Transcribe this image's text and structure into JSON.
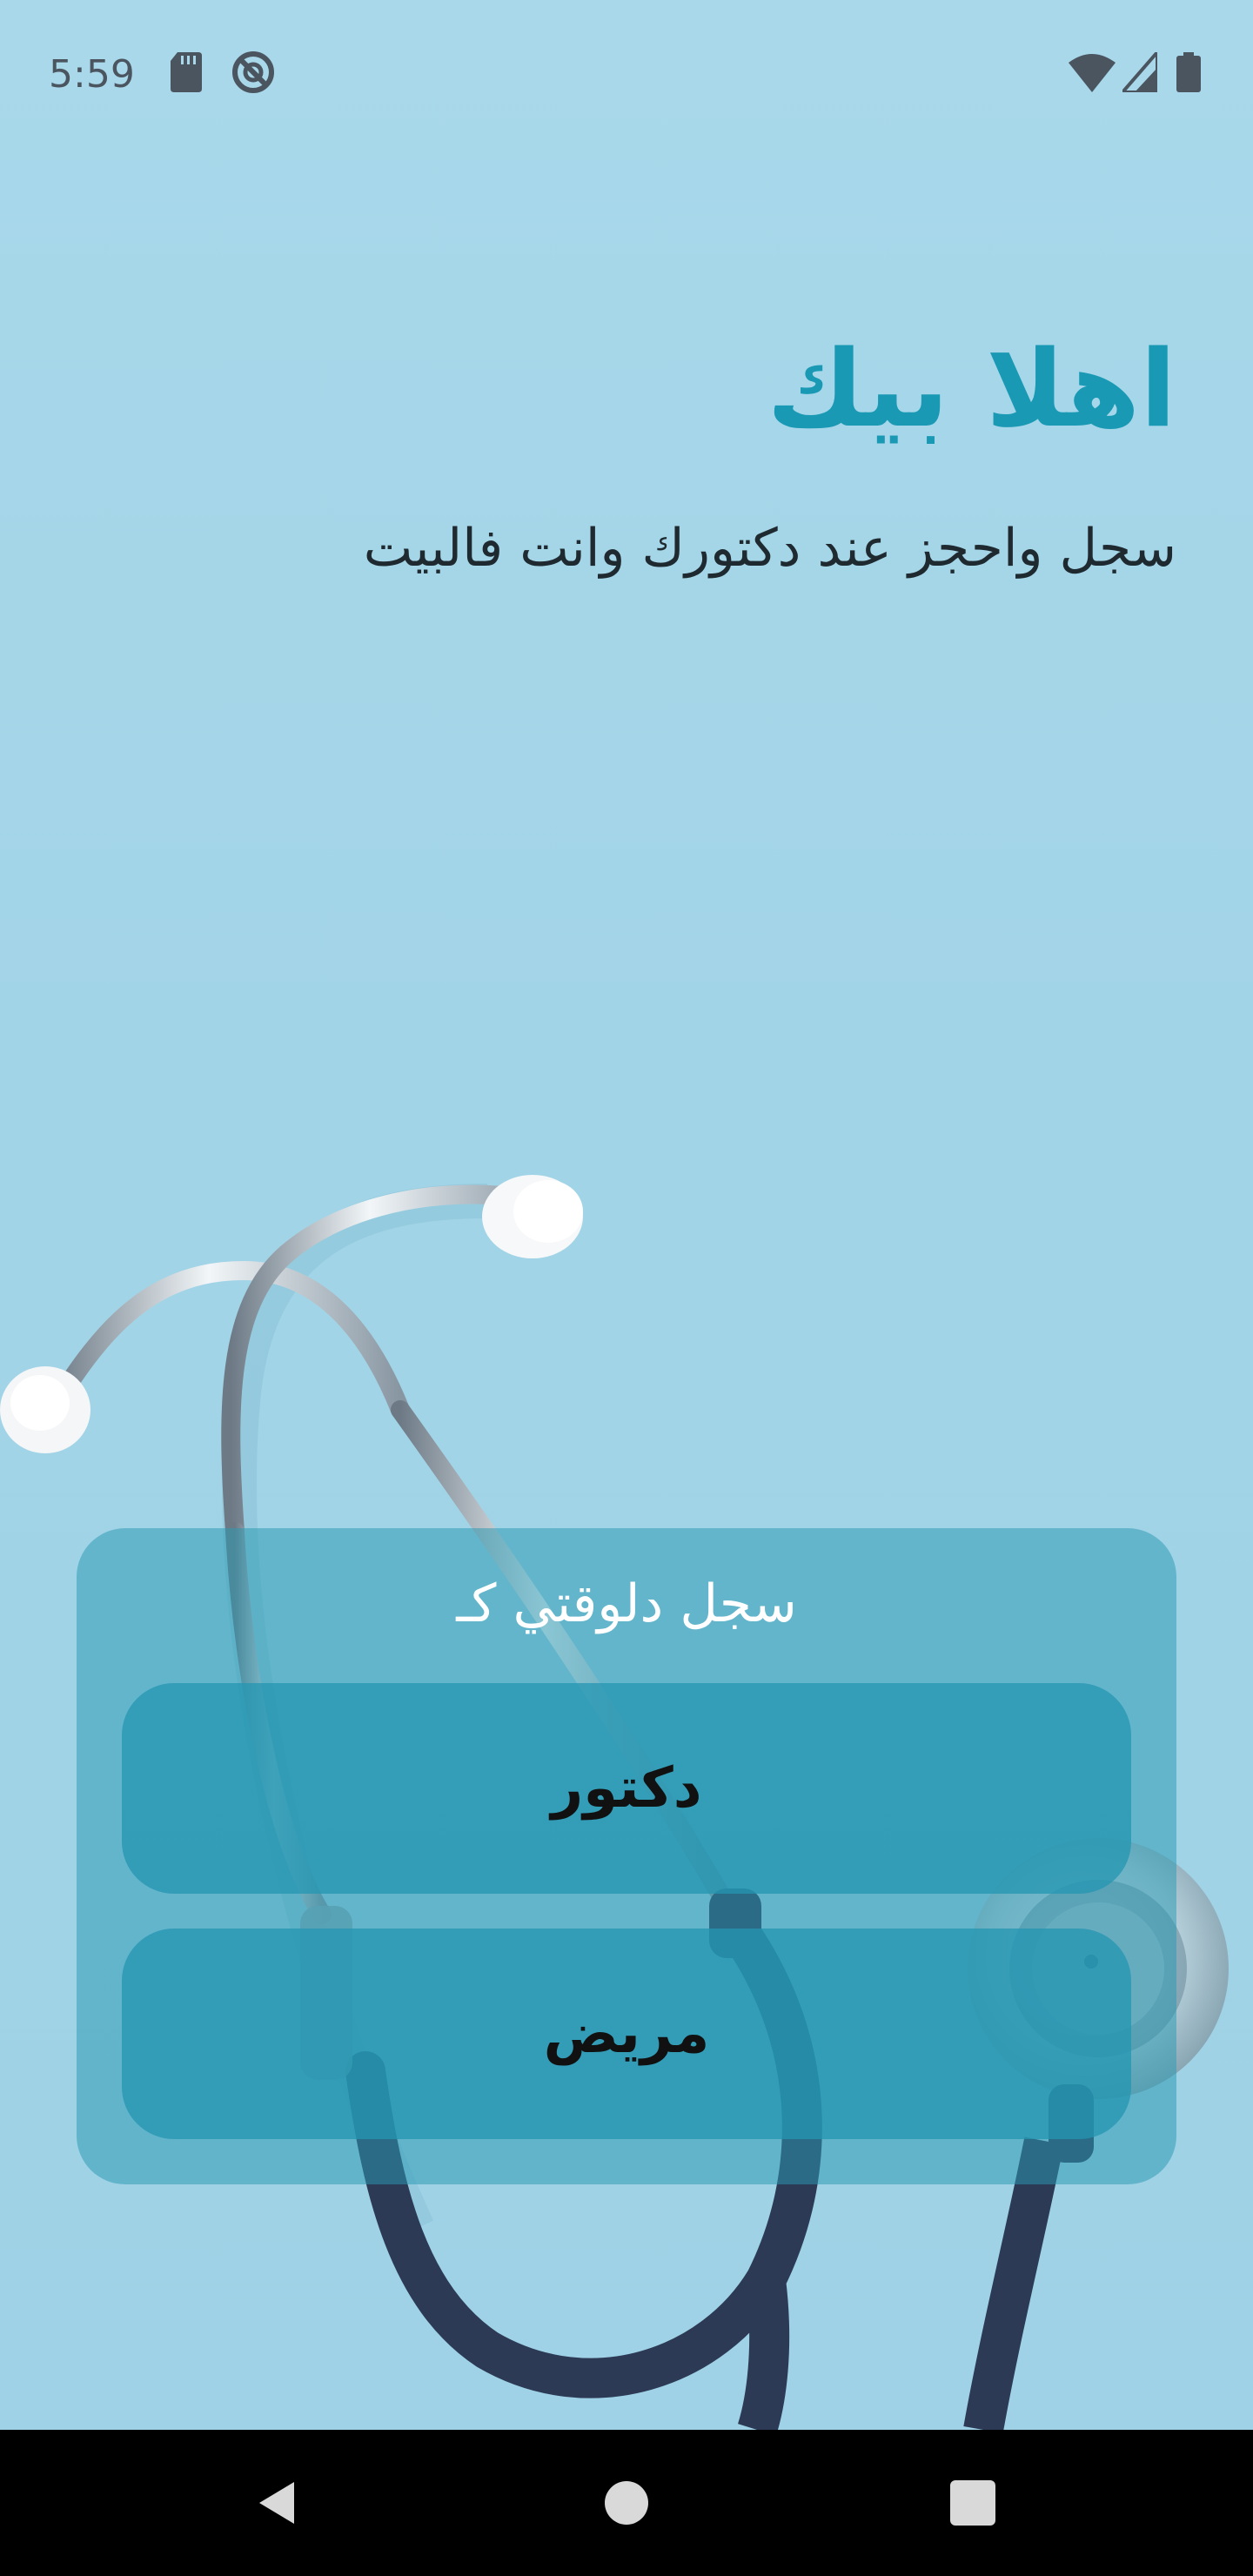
{
  "status_bar": {
    "time": "5:59",
    "left_icons": [
      "sd-card-icon",
      "do-not-disturb-icon"
    ],
    "right_icons": [
      "wifi-icon",
      "cell-signal-icon",
      "battery-icon"
    ]
  },
  "welcome": {
    "title": "اهلا بيك",
    "subtitle": "سجل واحجز عند دكتورك وانت فالبيت"
  },
  "registration_card": {
    "prompt": "سجل دلوقتي كـ",
    "doctor_button_label": "دكتور",
    "patient_button_label": "مريض"
  },
  "nav_bar": {
    "buttons": [
      "back-icon",
      "home-icon",
      "recents-icon"
    ]
  },
  "colors": {
    "background": "#a5d6e8",
    "title": "#1a99b5",
    "card": "#2b99b2",
    "button": "#2496b2"
  }
}
